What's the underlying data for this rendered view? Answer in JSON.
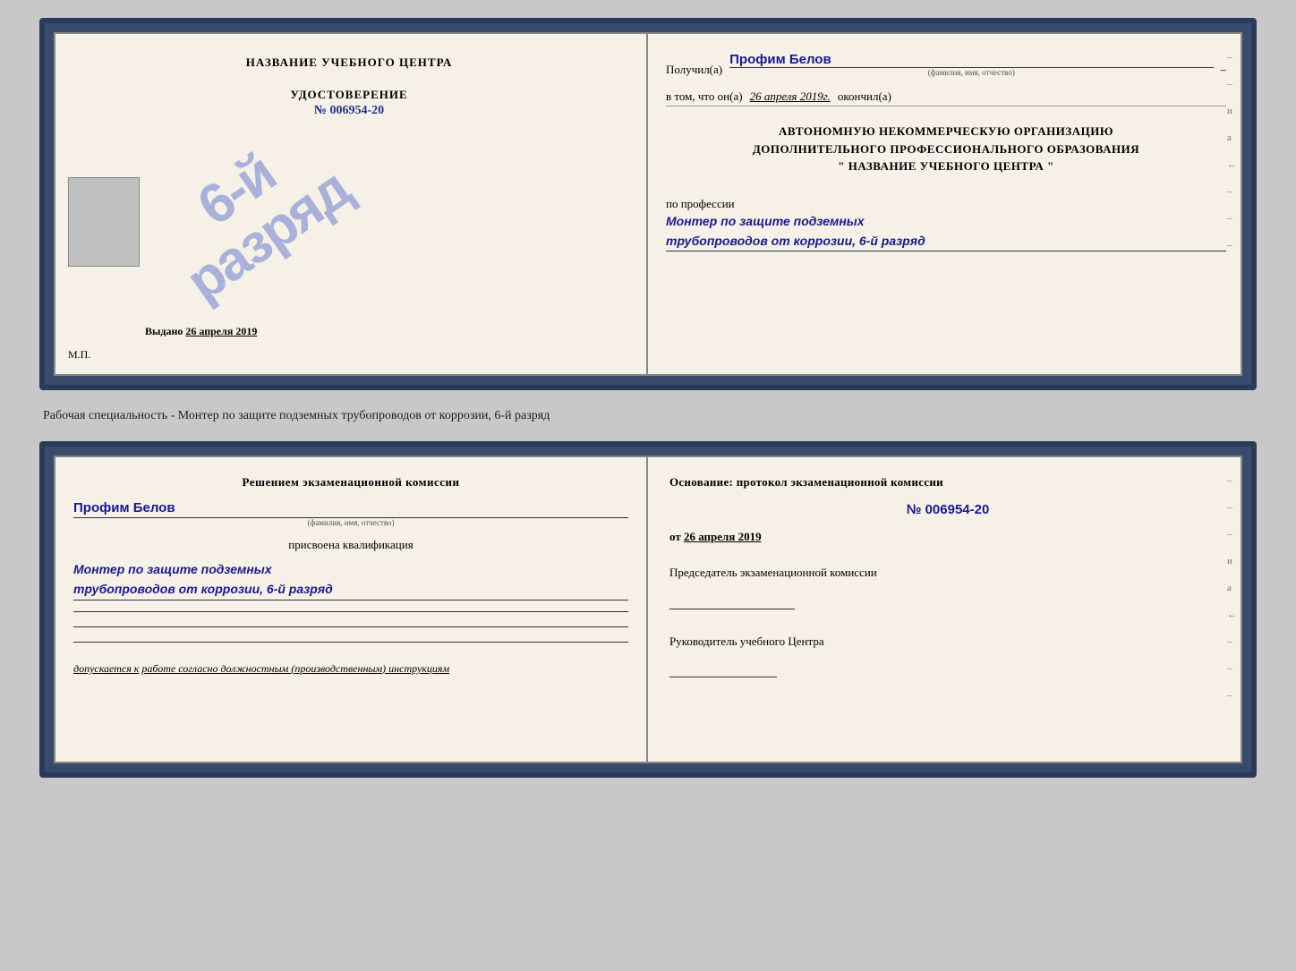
{
  "cert": {
    "left": {
      "top_title": "НАЗВАНИЕ УЧЕБНОГО ЦЕНТРА",
      "photo_alt": "photo",
      "doc_title": "УДОСТОВЕРЕНИЕ",
      "doc_number": "№ 006954-20",
      "stamp_line1": "6-й",
      "stamp_line2": "разряд",
      "issued_label": "Выдано",
      "issued_date": "26 апреля 2019",
      "mp_label": "М.П."
    },
    "right": {
      "received_label": "Получил(а)",
      "received_name": "Профим Белов",
      "received_name_sub": "(фамилия, имя, отчество)",
      "dash1": "–",
      "in_that_label": "в том, что он(а)",
      "date_value": "26 апреля 2019г.",
      "finished_label": "окончил(а)",
      "org_line1": "АВТОНОМНУЮ НЕКОММЕРЧЕСКУЮ ОРГАНИЗАЦИЮ",
      "org_line2": "ДОПОЛНИТЕЛЬНОГО ПРОФЕССИОНАЛЬНОГО ОБРАЗОВАНИЯ",
      "org_name": "\" НАЗВАНИЕ УЧЕБНОГО ЦЕНТРА \"",
      "profession_label": "по профессии",
      "profession_line1": "Монтер по защите подземных",
      "profession_line2": "трубопроводов от коррозии, 6-й разряд",
      "side_marks": [
        "–",
        "–",
        "и",
        "а",
        "←",
        "–",
        "–",
        "–"
      ]
    }
  },
  "specialty": {
    "text": "Рабочая специальность - Монтер по защите подземных трубопроводов от коррозии, 6-й разряд"
  },
  "qual": {
    "left": {
      "decision_title": "Решением экзаменационной комиссии",
      "name_value": "Профим Белов",
      "name_sub": "(фамилия, имя, отчество)",
      "assigned_label": "присвоена квалификация",
      "profession_line1": "Монтер по защите подземных",
      "profession_line2": "трубопроводов от коррозии, 6-й разряд",
      "допускается_label": "допускается к",
      "допускается_value": "работе согласно должностным (производственным) инструкциям"
    },
    "right": {
      "basis_label": "Основание: протокол экзаменационной комиссии",
      "basis_number": "№ 006954-20",
      "basis_date_prefix": "от",
      "basis_date": "26 апреля 2019",
      "chairman_label": "Председатель экзаменационной комиссии",
      "head_label": "Руководитель учебного Центра",
      "side_marks": [
        "–",
        "–",
        "–",
        "и",
        "а",
        "←",
        "–",
        "–",
        "–"
      ]
    }
  }
}
